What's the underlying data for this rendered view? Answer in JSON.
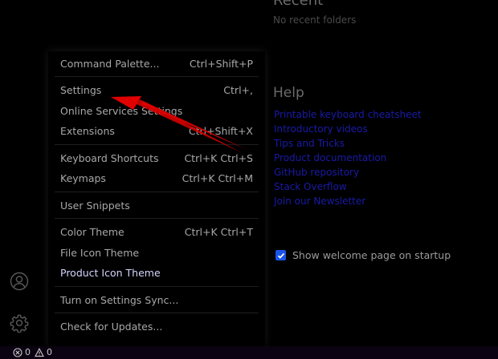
{
  "welcome": {
    "recent_title": "Recent",
    "recent_empty": "No recent folders",
    "help_title": "Help",
    "help_links": [
      "Printable keyboard cheatsheet",
      "Introductory videos",
      "Tips and Tricks",
      "Product documentation",
      "GitHub repository",
      "Stack Overflow",
      "Join our Newsletter"
    ],
    "show_on_startup_label": "Show welcome page on startup",
    "show_on_startup_checked": true
  },
  "menu": {
    "items": [
      {
        "label": "Command Palette...",
        "shortcut": "Ctrl+Shift+P"
      },
      {
        "label": "Settings",
        "shortcut": "Ctrl+,"
      },
      {
        "label": "Online Services Settings",
        "shortcut": ""
      },
      {
        "label": "Extensions",
        "shortcut": "Ctrl+Shift+X"
      },
      {
        "label": "Keyboard Shortcuts",
        "shortcut": "Ctrl+K Ctrl+S"
      },
      {
        "label": "Keymaps",
        "shortcut": "Ctrl+K Ctrl+M"
      },
      {
        "label": "User Snippets",
        "shortcut": ""
      },
      {
        "label": "Color Theme",
        "shortcut": "Ctrl+K Ctrl+T"
      },
      {
        "label": "File Icon Theme",
        "shortcut": ""
      },
      {
        "label": "Product Icon Theme",
        "shortcut": ""
      },
      {
        "label": "Turn on Settings Sync...",
        "shortcut": ""
      },
      {
        "label": "Check for Updates...",
        "shortcut": ""
      }
    ],
    "active_item": "Product Icon Theme"
  },
  "activity_bar": {
    "icons": [
      "account-icon",
      "manage-gear-icon"
    ]
  },
  "status_bar": {
    "errors": "0",
    "warnings": "0"
  },
  "colors": {
    "background": "#000000",
    "link": "#1a1aa8",
    "checkbox": "#1a55e8",
    "annotation_arrow": "#e00000"
  }
}
